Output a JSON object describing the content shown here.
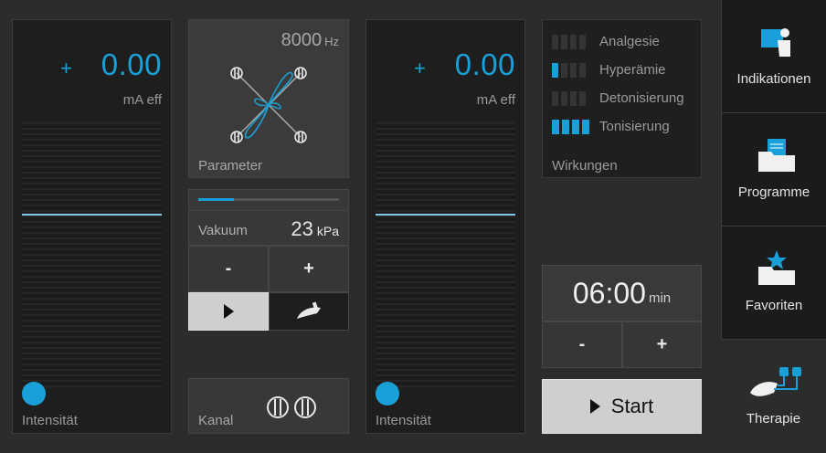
{
  "channel_left": {
    "plus": "+",
    "value": "0.00",
    "unit": "mA eff",
    "label": "Intensität"
  },
  "channel_right": {
    "plus": "+",
    "value": "0.00",
    "unit": "mA eff",
    "label": "Intensität"
  },
  "parameter": {
    "frequency": "8000",
    "frequency_unit": "Hz",
    "label": "Parameter"
  },
  "vacuum": {
    "label": "Vakuum",
    "value": "23",
    "unit": "kPa",
    "level": 0.25,
    "minus": "-",
    "plus": "+"
  },
  "kanal": {
    "label": "Kanal"
  },
  "wirkungen": {
    "label": "Wirkungen",
    "items": [
      {
        "label": "Analgesie",
        "level": 0
      },
      {
        "label": "Hyperämie",
        "level": 1
      },
      {
        "label": "Detonisierung",
        "level": 0
      },
      {
        "label": "Tonisierung",
        "level": 4
      }
    ]
  },
  "timer": {
    "value": "06:00",
    "unit": "min",
    "minus": "-",
    "plus": "+"
  },
  "start": {
    "label": "Start"
  },
  "nav": {
    "indikationen": "Indikationen",
    "programme": "Programme",
    "favoriten": "Favoriten",
    "therapie": "Therapie"
  },
  "colors": {
    "accent": "#1aa0d8",
    "background": "#2c2c2c",
    "panel": "#1e1e1e"
  }
}
